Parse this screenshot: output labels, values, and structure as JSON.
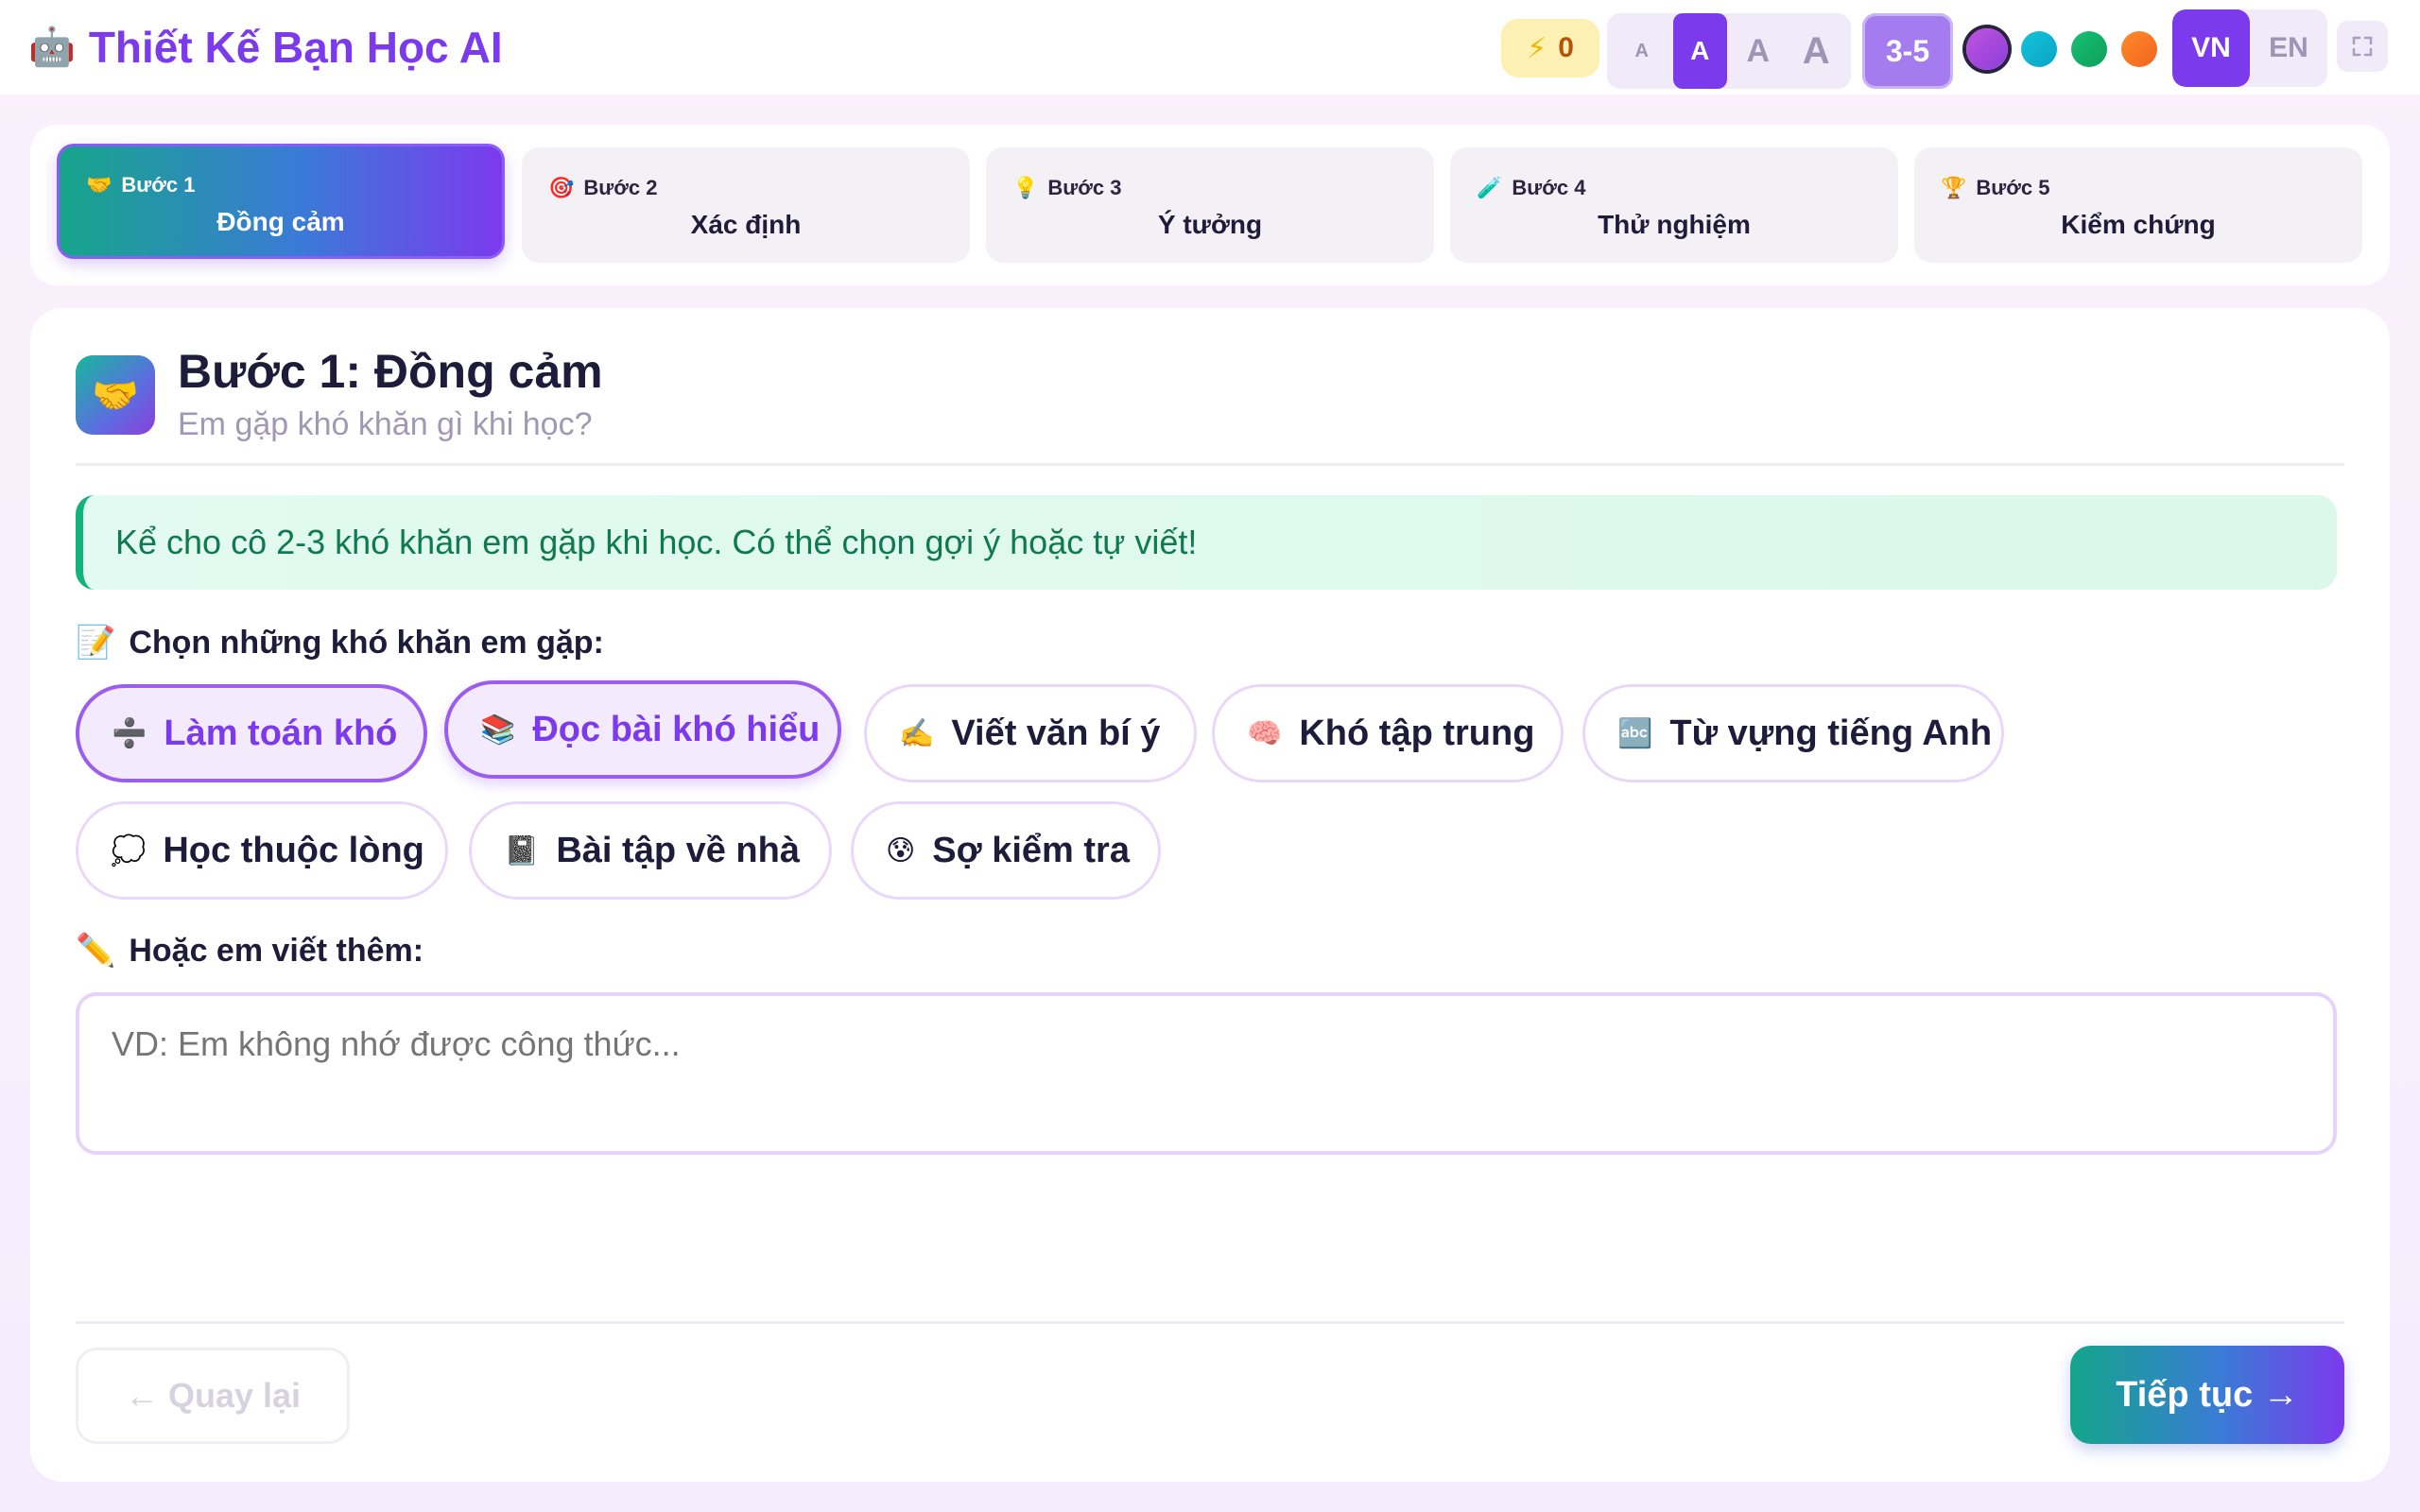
{
  "header": {
    "logo_icon": "robot-face",
    "title": "Thiết Kế Bạn Học AI",
    "xp_icon": "lightning-bolt",
    "xp_value": "0",
    "font_sizes": [
      "A",
      "A",
      "A",
      "A"
    ],
    "grade": "3-5",
    "themes": [
      "#a84ce0",
      "#0fb3d0",
      "#12ad68",
      "#f97320"
    ],
    "lang_vn": "VN",
    "lang_en": "EN",
    "fullscreen_icon": "expand-icon"
  },
  "steps": [
    {
      "num": "Bước 1",
      "name": "Đồng cảm",
      "icon": "🤝"
    },
    {
      "num": "Bước 2",
      "name": "Xác định",
      "icon": "🎯"
    },
    {
      "num": "Bước 3",
      "name": "Ý tưởng",
      "icon": "💡"
    },
    {
      "num": "Bước 4",
      "name": "Thử nghiệm",
      "icon": "🧪"
    },
    {
      "num": "Bước 5",
      "name": "Kiểm chứng",
      "icon": "🏆"
    }
  ],
  "main": {
    "icon": "🤝",
    "title": "Bước 1: Đồng cảm",
    "subtitle": "Em gặp khó khăn gì khi học?",
    "notice": "Kể cho cô 2-3 khó khăn em gặp khi học. Có thể chọn gợi ý hoặc tự viết!",
    "choose_label": "Chọn những khó khăn em gặp:",
    "choose_icon": "📝",
    "chips": [
      {
        "emoji": "➗",
        "label": "Làm toán khó"
      },
      {
        "emoji": "📚",
        "label": "Đọc bài khó hiểu"
      },
      {
        "emoji": "✍️",
        "label": "Viết văn bí ý"
      },
      {
        "emoji": "🧠",
        "label": "Khó tập trung"
      },
      {
        "emoji": "🔤",
        "label": "Từ vựng tiếng Anh"
      },
      {
        "emoji": "💭",
        "label": "Học thuộc lòng"
      },
      {
        "emoji": "📓",
        "label": "Bài tập về nhà"
      },
      {
        "emoji": "😰",
        "label": "Sợ kiểm tra"
      }
    ],
    "write_label": "Hoặc em viết thêm:",
    "write_icon": "✏️",
    "textarea_placeholder": "VD: Em không nhớ được công thức...",
    "back_button": "← Quay lại",
    "next_button": "Tiếp tục →"
  }
}
